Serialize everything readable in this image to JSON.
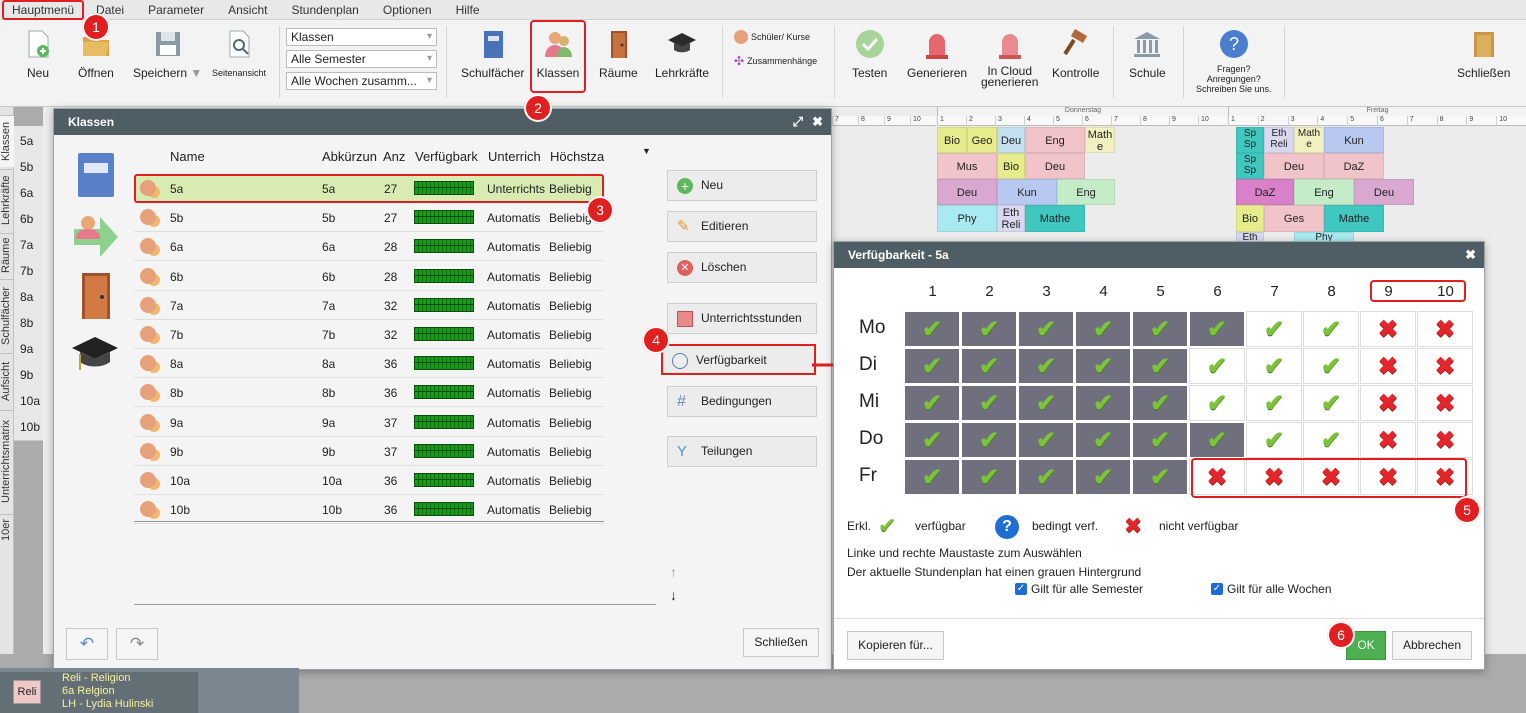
{
  "menu": [
    "Hauptmenü",
    "Datei",
    "Parameter",
    "Ansicht",
    "Stundenplan",
    "Optionen",
    "Hilfe"
  ],
  "ribbon": {
    "neu": "Neu",
    "oeffnen": "Öffnen",
    "speichern": "Speichern",
    "seitenansicht": "Seitenansicht",
    "sel1": "Klassen",
    "sel2": "Alle Semester",
    "sel3": "Alle Wochen zusamm...",
    "schulfaecher": "Schulfächer",
    "klassen": "Klassen",
    "raeume": "Räume",
    "lehrkraefte": "Lehrkräfte",
    "schueler_kurse": "Schüler/ Kurse",
    "zusammenhaenge": "Zusammenhänge",
    "testen": "Testen",
    "generieren": "Generieren",
    "incloud1": "In Cloud",
    "incloud2": "generieren",
    "kontrolle": "Kontrolle",
    "schule": "Schule",
    "fragen1": "Fragen?",
    "fragen2": "Anregungen?",
    "fragen3": "Schreiben Sie uns.",
    "schliessen": "Schließen"
  },
  "sidetabs": [
    "Klassen",
    "Lehrkräfte",
    "Räume",
    "Schulfächer",
    "Aufsicht",
    "Unterrichtsmatrix",
    "10er"
  ],
  "rows": [
    "5a",
    "5b",
    "6a",
    "6b",
    "7a",
    "7b",
    "8a",
    "8b",
    "9a",
    "9b",
    "10a",
    "10b"
  ],
  "days": {
    "donnerstag": "Donnerstag",
    "freitag": "Freitag"
  },
  "bg_cells": {
    "do5a": [
      "Bio",
      "Geo",
      "Deu",
      "Eng",
      "Math e"
    ],
    "do5b": [
      "Mus",
      "Bio",
      "Deu"
    ],
    "do6a": [
      "Deu",
      "Kun",
      "Eng"
    ],
    "do6b": [
      "Phy",
      "Eth Reli",
      "Mathe"
    ],
    "fr5a": [
      "Sp Sp",
      "Eth Reli",
      "Math e",
      "Kun"
    ],
    "fr5b": [
      "Sp Sp",
      "Deu",
      "DaZ"
    ],
    "fr6a": [
      "DaZ",
      "Eng",
      "Deu"
    ],
    "fr6b": [
      "Bio",
      "Ges",
      "Mathe"
    ],
    "fr7a": [
      "Eth",
      "Phy"
    ]
  },
  "klassen_dialog": {
    "title": "Klassen",
    "headers": [
      "Name",
      "Abkürzun",
      "Anz",
      "Verfügbark",
      "Unterrich",
      "Höchstza"
    ],
    "rows": [
      {
        "name": "5a",
        "abk": "5a",
        "anz": "27",
        "unt": "Unterrichts",
        "hoe": "Beliebig"
      },
      {
        "name": "5b",
        "abk": "5b",
        "anz": "27",
        "unt": "Automatis",
        "hoe": "Beliebig"
      },
      {
        "name": "6a",
        "abk": "6a",
        "anz": "28",
        "unt": "Automatis",
        "hoe": "Beliebig"
      },
      {
        "name": "6b",
        "abk": "6b",
        "anz": "28",
        "unt": "Automatis",
        "hoe": "Beliebig"
      },
      {
        "name": "7a",
        "abk": "7a",
        "anz": "32",
        "unt": "Automatis",
        "hoe": "Beliebig"
      },
      {
        "name": "7b",
        "abk": "7b",
        "anz": "32",
        "unt": "Automatis",
        "hoe": "Beliebig"
      },
      {
        "name": "8a",
        "abk": "8a",
        "anz": "36",
        "unt": "Automatis",
        "hoe": "Beliebig"
      },
      {
        "name": "8b",
        "abk": "8b",
        "anz": "36",
        "unt": "Automatis",
        "hoe": "Beliebig"
      },
      {
        "name": "9a",
        "abk": "9a",
        "anz": "37",
        "unt": "Automatis",
        "hoe": "Beliebig"
      },
      {
        "name": "9b",
        "abk": "9b",
        "anz": "37",
        "unt": "Automatis",
        "hoe": "Beliebig"
      },
      {
        "name": "10a",
        "abk": "10a",
        "anz": "36",
        "unt": "Automatis",
        "hoe": "Beliebig"
      },
      {
        "name": "10b",
        "abk": "10b",
        "anz": "36",
        "unt": "Automatis",
        "hoe": "Beliebig"
      }
    ],
    "actions": [
      "Neu",
      "Editieren",
      "Löschen",
      "Unterrichtsstunden",
      "Verfügbarkeit",
      "Bedingungen",
      "Teilungen"
    ],
    "close": "Schließen"
  },
  "avail_dialog": {
    "title": "Verfügbarkeit - 5a",
    "cols": [
      "1",
      "2",
      "3",
      "4",
      "5",
      "6",
      "7",
      "8",
      "9",
      "10"
    ],
    "days": [
      "Mo",
      "Di",
      "Mi",
      "Do",
      "Fr"
    ],
    "grid": [
      "YYYYYYYYNN",
      "YYYYYYYYNN",
      "YYYYYYYYNN",
      "YYYYYYYYNN",
      "YYYYYNNNNN"
    ],
    "grey": [
      [
        1,
        1,
        1,
        1,
        1,
        1,
        0,
        0,
        0,
        0
      ],
      [
        1,
        1,
        1,
        1,
        1,
        0,
        0,
        0,
        0,
        0
      ],
      [
        1,
        1,
        1,
        1,
        1,
        0,
        0,
        0,
        0,
        0
      ],
      [
        1,
        1,
        1,
        1,
        1,
        1,
        0,
        0,
        0,
        0
      ],
      [
        1,
        1,
        1,
        1,
        1,
        0,
        0,
        0,
        0,
        0
      ]
    ],
    "legend_erkl": "Erkl.",
    "legend_verf": "verfügbar",
    "legend_bed": "bedingt verf.",
    "legend_nicht": "nicht verfügbar",
    "note1": "Linke und rechte Maustaste zum Auswählen",
    "note2": "Der aktuelle Stundenplan hat einen grauen Hintergrund",
    "cb1": "Gilt für alle Semester",
    "cb2": "Gilt für alle Wochen",
    "kopieren": "Kopieren für...",
    "ok": "OK",
    "abbrechen": "Abbrechen"
  },
  "badges": [
    "1",
    "2",
    "3",
    "4",
    "5",
    "6"
  ],
  "bottom": {
    "reli": "Reli",
    "line1": "Reli - Religion",
    "line2": "6a Relgion",
    "line3": "LH - Lydia Hulinski"
  },
  "colors": {
    "accent_red": "#e02020",
    "title_bar": "#4f5e64",
    "ok_green": "#4caf50"
  }
}
